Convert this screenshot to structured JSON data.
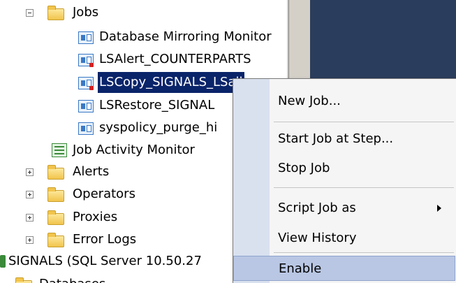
{
  "tree": {
    "jobs_folder": "Jobs",
    "jobs": [
      "Database Mirroring Monitor",
      "LSAlert_COUNTERPARTS",
      "LSCopy_SIGNALS_LSall",
      "LSRestore_SIGNAL",
      "syspolicy_purge_hi"
    ],
    "job_activity_monitor": "Job Activity Monitor",
    "alerts": "Alerts",
    "operators": "Operators",
    "proxies": "Proxies",
    "error_logs": "Error Logs",
    "server": "SIGNALS (SQL Server 10.50.27",
    "databases": "Databases"
  },
  "context_menu": {
    "new_job": "New Job...",
    "start_job_at_step": "Start Job at Step...",
    "stop_job": "Stop Job",
    "script_job_as": "Script Job as",
    "view_history": "View History",
    "enable": "Enable"
  },
  "colors": {
    "selection": "#0a246a",
    "menu_highlight": "#b9c7e4",
    "right_pane": "#2b3d5c"
  }
}
